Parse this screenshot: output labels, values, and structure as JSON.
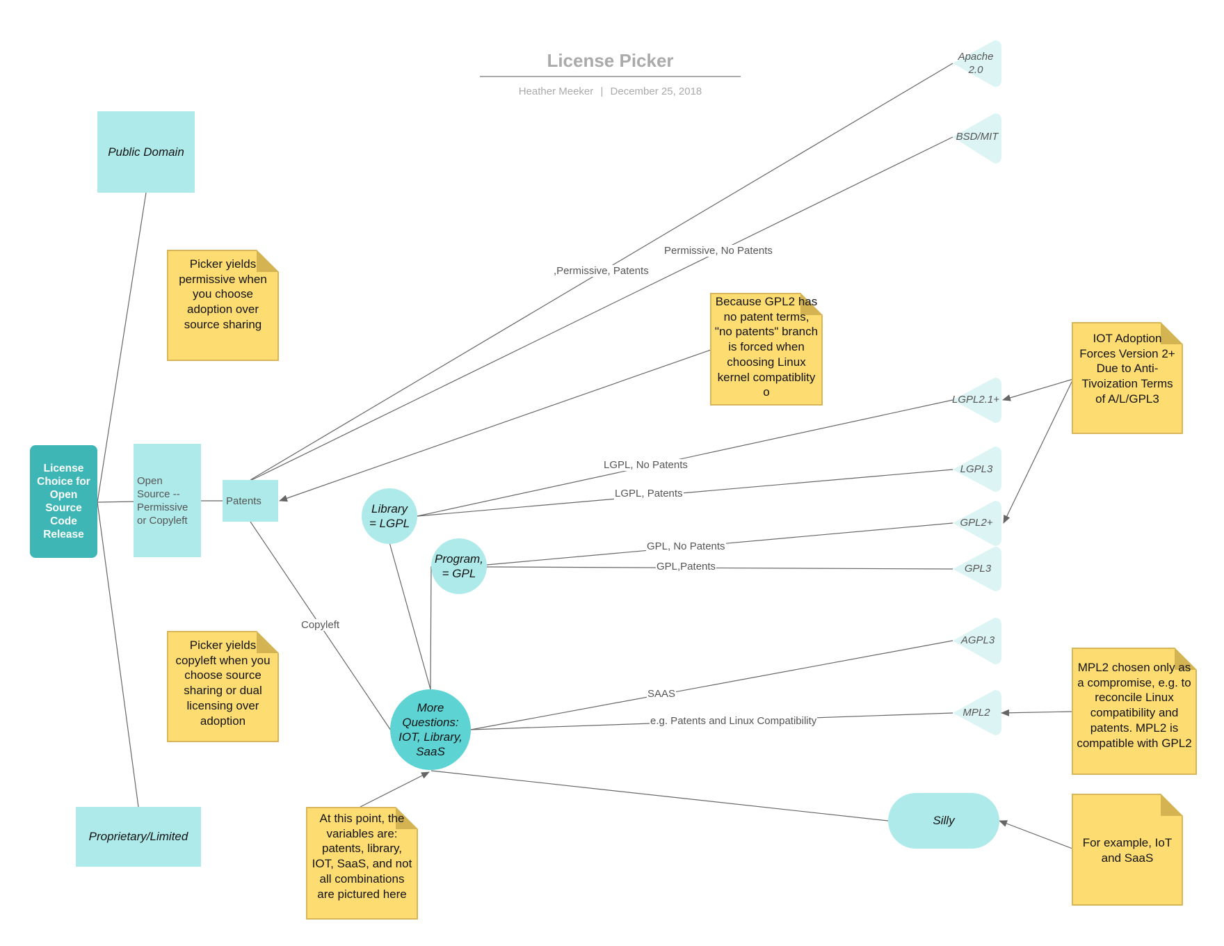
{
  "header": {
    "title": "License Picker",
    "author": "Heather Meeker",
    "separator": "|",
    "date": "December 25, 2018"
  },
  "nodes": {
    "root": "License Choice for Open Source Code Release",
    "public_domain": "Public Domain",
    "proprietary": "Proprietary/Limited",
    "open_source": "Open Source -- Permissive or Copyleft",
    "patents": "Patents",
    "library": "Library = LGPL",
    "program": "Program, = GPL",
    "more_questions": "More Questions: IOT, Library, SaaS",
    "silly": "Silly"
  },
  "licenses": {
    "apache": "Apache 2.0",
    "bsd_mit": "BSD/MIT",
    "lgpl21": "LGPL2.1+",
    "lgpl3": "LGPL3",
    "gpl2": "GPL2+",
    "gpl3": "GPL3",
    "agpl3": "AGPL3",
    "mpl2": "MPL2"
  },
  "edge_labels": {
    "permissive_patents": ",Permissive, Patents",
    "permissive_no_patents": "Permissive, No Patents",
    "lgpl_no_patents": "LGPL, No Patents",
    "lgpl_patents": "LGPL, Patents",
    "gpl_no_patents": "GPL, No Patents",
    "gpl_patents": "GPL,Patents",
    "copyleft": "Copyleft",
    "saas": "SAAS",
    "patents_linux": "e.g. Patents  and Linux Compatibility"
  },
  "notes": {
    "permissive": "Picker yields permissive when you choose adoption over source sharing",
    "copyleft": "Picker yields copyleft when you choose source sharing or dual licensing over adoption",
    "gpl2": "Because GPL2 has no patent terms, \"no patents\" branch is forced when choosing Linux kernel compatiblity o",
    "iot": "IOT Adoption Forces Version 2+ Due to Anti-Tivoization Terms of A/L/GPL3",
    "mpl2": "MPL2 chosen only as a compromise, e.g. to reconcile Linux compatibility and patents. MPL2 is compatible with GPL2",
    "example": "For example, IoT and SaaS",
    "variables": "At this point, the variables are: patents, library, IOT, SaaS, and not all combinations are pictured here"
  },
  "colors": {
    "shape_fill": "#AFEAEA",
    "root_fill": "#3FB6B6",
    "circle_dark": "#5DD3D3",
    "license_fill": "#DDF4F4",
    "note_fill": "#FDDD72",
    "note_border": "#D9B55A",
    "line": "#666666"
  }
}
